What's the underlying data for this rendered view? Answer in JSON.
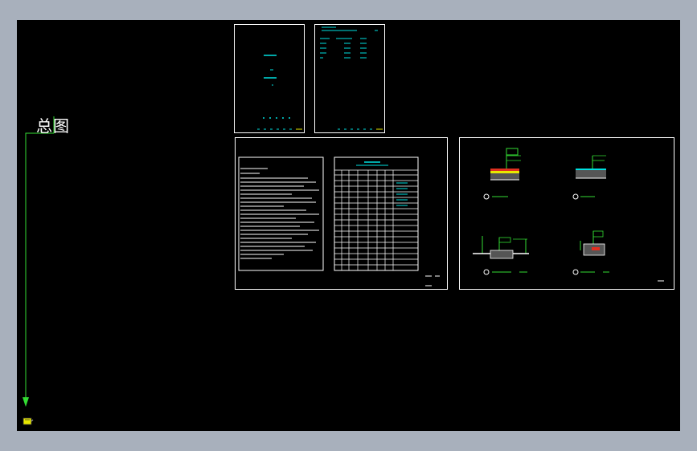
{
  "viewport": {
    "background": "#000000",
    "frame_color": "#a8b0bc"
  },
  "label": {
    "text": "总图"
  },
  "colors": {
    "line": "#ffffff",
    "cyan": "#00e0e0",
    "green": "#33dd33",
    "yellow": "#e8e800",
    "red": "#e03020"
  },
  "sheets": [
    {
      "name": "cover-sheet"
    },
    {
      "name": "index-sheet"
    },
    {
      "name": "design-notes-sheet"
    },
    {
      "name": "details-sheet"
    }
  ],
  "details": {
    "markers": [
      "1",
      "2",
      "3",
      "4"
    ]
  },
  "icons": {
    "ucs": "ucs-icon",
    "arrow": "down-arrow-icon"
  }
}
